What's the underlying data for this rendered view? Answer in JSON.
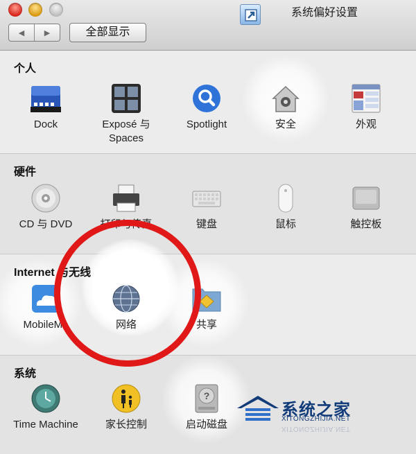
{
  "window": {
    "title": "系统偏好设置",
    "nav_back": "◀",
    "nav_forward": "▶",
    "show_all": "全部显示"
  },
  "sections": [
    {
      "title": "个人",
      "items": [
        {
          "label": "Dock",
          "icon": "dock-icon"
        },
        {
          "label": "Exposé 与\nSpaces",
          "icon": "expose-icon"
        },
        {
          "label": "Spotlight",
          "icon": "spotlight-icon"
        },
        {
          "label": "安全",
          "icon": "security-house-icon"
        },
        {
          "label": "外观",
          "icon": "appearance-icon"
        }
      ]
    },
    {
      "title": "硬件",
      "items": [
        {
          "label": "CD 与 DVD",
          "icon": "cd-icon"
        },
        {
          "label": "打印与传真",
          "icon": "printer-icon"
        },
        {
          "label": "键盘",
          "icon": "keyboard-icon"
        },
        {
          "label": "鼠标",
          "icon": "mouse-icon"
        },
        {
          "label": "触控板",
          "icon": "trackpad-icon"
        }
      ]
    },
    {
      "title": "Internet 与无线",
      "items": [
        {
          "label": "MobileMe",
          "icon": "cloud-icon"
        },
        {
          "label": "网络",
          "icon": "globe-icon"
        },
        {
          "label": "共享",
          "icon": "sharing-folder-icon"
        }
      ]
    },
    {
      "title": "系统",
      "items": [
        {
          "label": "Time Machine",
          "icon": "time-machine-icon"
        },
        {
          "label": "家长控制",
          "icon": "parental-controls-icon"
        },
        {
          "label": "启动磁盘",
          "icon": "startup-disk-icon"
        }
      ]
    }
  ],
  "watermark": {
    "title": "系统之家",
    "url": "XITONGZHIJIA.NET"
  },
  "colors": {
    "highlight_ring": "#e01818",
    "watermark": "#123b7a"
  }
}
